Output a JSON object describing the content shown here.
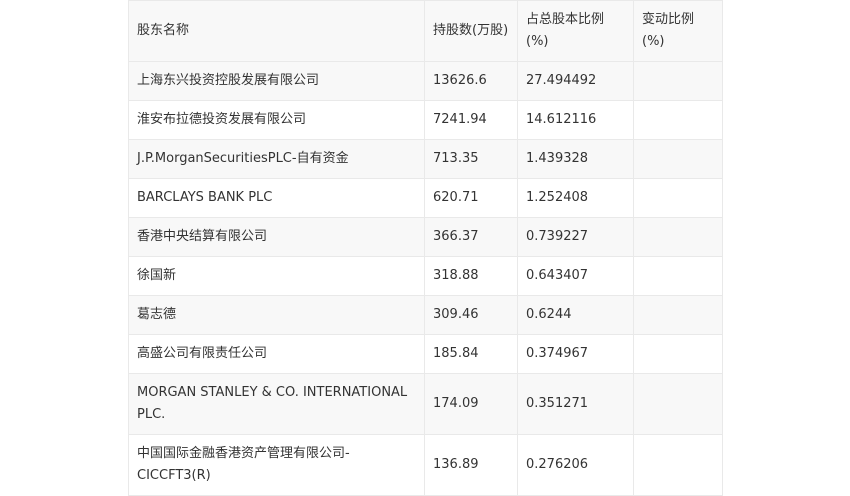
{
  "table": {
    "headers": [
      "股东名称",
      "持股数(万股)",
      "占总股本比例(%)",
      "变动比例(%)"
    ],
    "rows": [
      {
        "name": "上海东兴投资控股发展有限公司",
        "shares": "13626.6",
        "ratio": "27.494492",
        "change": ""
      },
      {
        "name": "淮安布拉德投资发展有限公司",
        "shares": "7241.94",
        "ratio": "14.612116",
        "change": ""
      },
      {
        "name": "J.P.MorganSecuritiesPLC-自有资金",
        "shares": "713.35",
        "ratio": "1.439328",
        "change": ""
      },
      {
        "name": "BARCLAYS BANK PLC",
        "shares": "620.71",
        "ratio": "1.252408",
        "change": ""
      },
      {
        "name": "香港中央结算有限公司",
        "shares": "366.37",
        "ratio": "0.739227",
        "change": ""
      },
      {
        "name": "徐国新",
        "shares": "318.88",
        "ratio": "0.643407",
        "change": ""
      },
      {
        "name": "葛志德",
        "shares": "309.46",
        "ratio": "0.6244",
        "change": ""
      },
      {
        "name": "高盛公司有限责任公司",
        "shares": "185.84",
        "ratio": "0.374967",
        "change": ""
      },
      {
        "name": "MORGAN STANLEY & CO. INTERNATIONAL PLC.",
        "shares": "174.09",
        "ratio": "0.351271",
        "change": ""
      },
      {
        "name": "中国国际金融香港资产管理有限公司-CICCFT3(R)",
        "shares": "136.89",
        "ratio": "0.276206",
        "change": ""
      }
    ]
  }
}
